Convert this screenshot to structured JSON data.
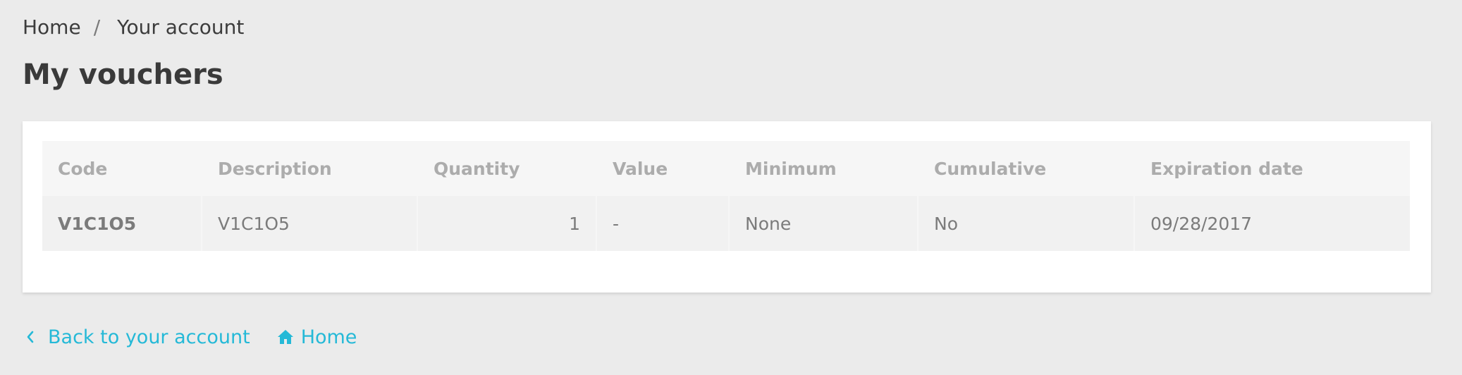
{
  "breadcrumb": {
    "items": [
      "Home",
      "Your account"
    ],
    "separator": "/"
  },
  "page": {
    "title": "My vouchers"
  },
  "table": {
    "columns": [
      "Code",
      "Description",
      "Quantity",
      "Value",
      "Minimum",
      "Cumulative",
      "Expiration date"
    ],
    "rows": [
      {
        "code": "V1C1O5",
        "description": "V1C1O5",
        "quantity": "1",
        "value": "-",
        "minimum": "None",
        "cumulative": "No",
        "expiration_date": "09/28/2017"
      }
    ]
  },
  "footer": {
    "back_label": "Back to your account",
    "back_icon": "chevron-left-icon",
    "home_label": "Home",
    "home_icon": "home-icon"
  },
  "colors": {
    "accent": "#25b9d7",
    "background": "#ebebeb",
    "card": "#ffffff"
  }
}
